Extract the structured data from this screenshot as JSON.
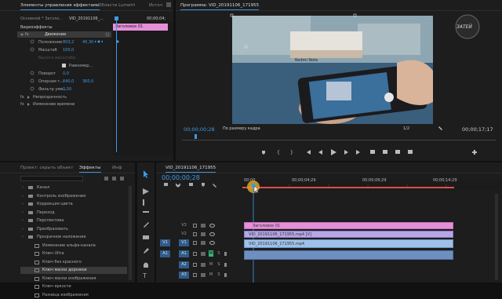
{
  "effect_controls": {
    "tabs": [
      "Элементы управления эффектами",
      "Области Lumetri",
      "Источ"
    ],
    "source_label": "Основной * Заголо...",
    "seq_label": "VID_20191106_...",
    "timecode_top": "00;00;04;",
    "clip_bar_label": "Заголовок 01",
    "section_video": "Видеоэффекты",
    "fx_motion": "Движение",
    "props": [
      {
        "label": "Положение",
        "v1": "803,2",
        "v2": "40,30"
      },
      {
        "label": "Масштаб",
        "v1": "100,0",
        "v2": ""
      },
      {
        "label": "Высота масштаба",
        "v1": "",
        "v2": ""
      },
      {
        "label": "Равномер...",
        "v1": "",
        "v2": ""
      },
      {
        "label": "Поворот",
        "v1": "0,0",
        "v2": ""
      },
      {
        "label": "Опорная т...",
        "v1": "640,0",
        "v2": "360,0"
      },
      {
        "label": "Фильтр уме...",
        "v1": "0,00",
        "v2": ""
      }
    ],
    "fx_opacity": "Непрозрачность",
    "fx_time": "Изменение времени"
  },
  "program_monitor": {
    "title": "Программа: VID_20191106_171955",
    "timecode_left": "00;00;00;28",
    "fit_label": "По размеру кадра",
    "ratio": "1/2",
    "timecode_right": "00;00;17;17",
    "watermark": "ЗАТЕЙ"
  },
  "effects_panel": {
    "tabs": [
      "Проект: скрыть объект",
      "Эффекты",
      "Инф"
    ],
    "search_placeholder": "",
    "folders": [
      "Канал",
      "Контроль изображения",
      "Коррекция цвета",
      "Переход",
      "Перспектива",
      "Преобразовать",
      "Прозрачное наложение"
    ],
    "items": [
      "Изменение альфа-канала",
      "Ключ Ultra",
      "Ключ без красного",
      "Ключ маски дорожки",
      "Ключ маски изображения",
      "Ключ яркости",
      "Разница изображения"
    ],
    "selected_index": 3
  },
  "timeline": {
    "tab_label": "VID_20191106_171955",
    "timecode": "00;00;00;28",
    "ruler_labels": [
      "00;00",
      "00;00;04;29",
      "00;00;09;29",
      "00;00;14;29"
    ],
    "tracks": [
      {
        "name": "V3",
        "src": ""
      },
      {
        "name": "V2",
        "src": ""
      },
      {
        "name": "V1",
        "src": "V1"
      },
      {
        "name": "A1",
        "src": "A1"
      },
      {
        "name": "A2",
        "src": ""
      },
      {
        "name": "A3",
        "src": ""
      }
    ],
    "clips": [
      {
        "label": "Заголовок 01",
        "color": "#e58fd8"
      },
      {
        "label": "VID_20191106_171955.mp4 [V]",
        "color": "#b7a7e6"
      },
      {
        "label": "VID_20191106_171955.mp4",
        "color": "#9fc1e9"
      },
      {
        "label": "",
        "color": "#6f8fbf"
      }
    ]
  },
  "colors": {
    "accent_blue": "#3c9be8",
    "playhead": "#e34b4b",
    "title_clip": "#e58fd8"
  }
}
